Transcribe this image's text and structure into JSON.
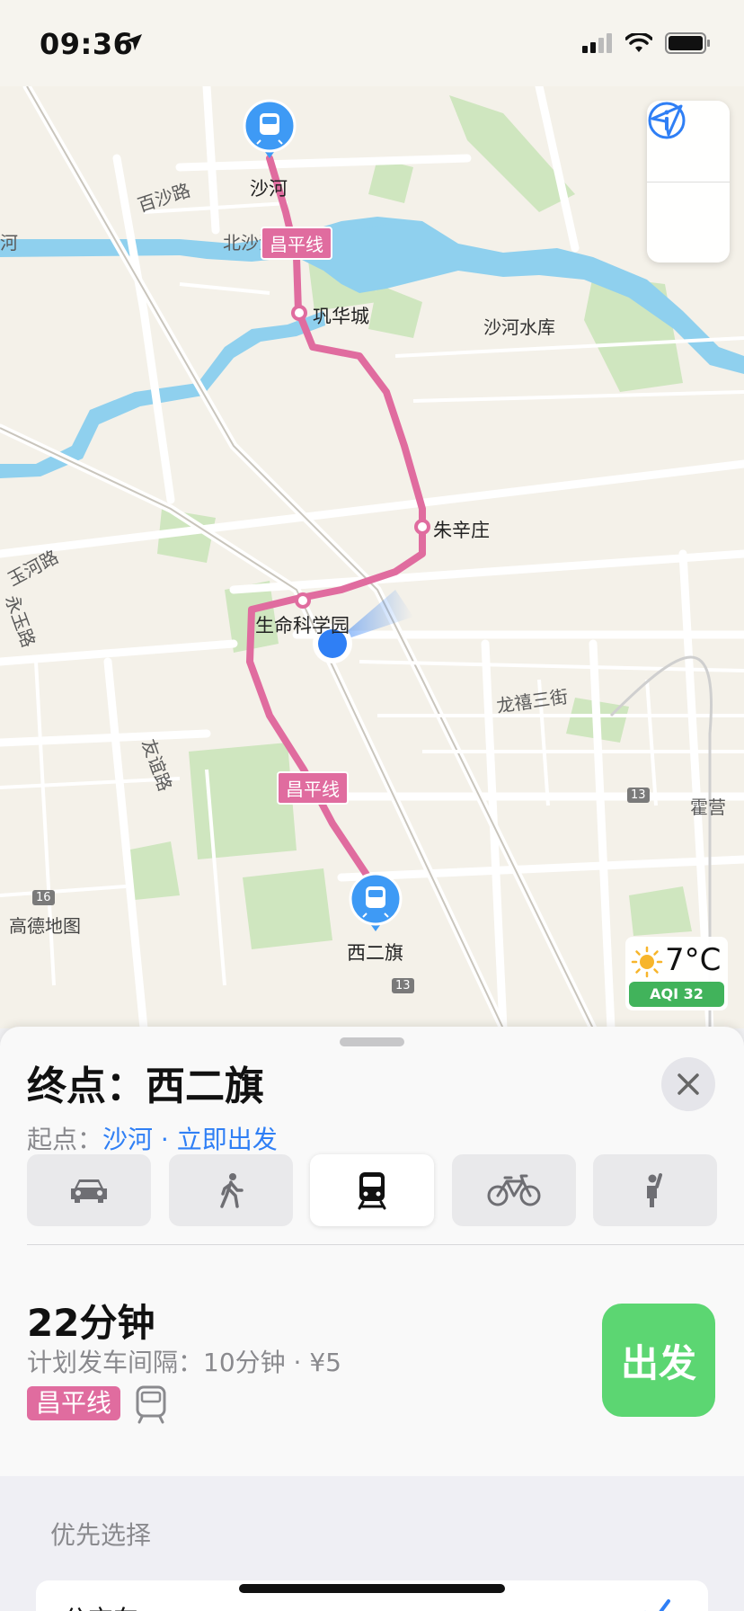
{
  "status_bar": {
    "time": "09:36"
  },
  "map": {
    "labels": {
      "baisha_road": "百沙路",
      "beishahe": "北沙河",
      "shahe_reservoir": "沙河水库",
      "yuhe_road": "玉河路",
      "yongyu_road": "永玉路",
      "youyi_road": "友谊路",
      "longxi_3rd_st": "龙禧三街",
      "huoying": "霍营",
      "river_he": "河"
    },
    "stations": {
      "shahe": "沙河",
      "gonghuacheng": "巩华城",
      "zhuxinzhuang": "朱辛庄",
      "life_science_park": "生命科学园",
      "xierqi": "西二旗"
    },
    "line_badge_top": "昌平线",
    "line_badge_bottom": "昌平线",
    "road_shields": {
      "a": "13",
      "b": "13",
      "c": "16"
    },
    "weather": {
      "temp": "7°C",
      "aqi": "AQI 32"
    },
    "attribution": "高德地图"
  },
  "sheet": {
    "destination": "终点：西二旗",
    "origin_prefix": "起点：",
    "origin_link": "沙河 · 立即出发",
    "modes": [
      {
        "name": "car",
        "icon": "car-icon"
      },
      {
        "name": "walk",
        "icon": "walk-icon"
      },
      {
        "name": "transit",
        "icon": "train-icon",
        "active": true
      },
      {
        "name": "bike",
        "icon": "bike-icon"
      },
      {
        "name": "ride-hailing",
        "icon": "hail-icon"
      }
    ],
    "route": {
      "duration": "22分钟",
      "detail": "计划发车间隔：10分钟 · ¥5",
      "line": "昌平线",
      "go_label": "出发"
    },
    "preferences": {
      "title": "优先选择",
      "item": "公交车"
    }
  },
  "colors": {
    "line_pink": "#e06c9f",
    "accent_blue": "#2f7ff5",
    "go_green": "#5cd672",
    "aqi_green": "#41b35b",
    "water": "#8fd0ee",
    "park": "#cfe6bf"
  }
}
